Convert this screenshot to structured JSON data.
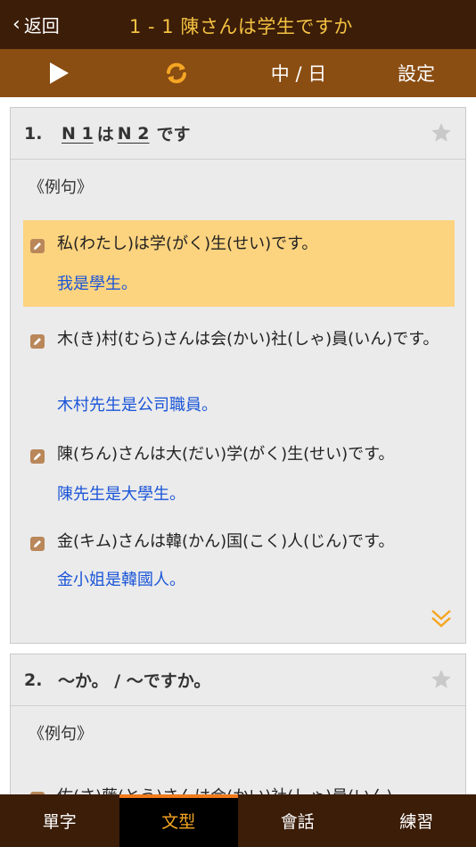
{
  "header": {
    "back_label": "返回",
    "title": "1 - 1 陳さんは学生ですか"
  },
  "toolbar": {
    "play_icon": "play-icon",
    "repeat_icon": "repeat-icon",
    "lang_label": "中 / 日",
    "settings_label": "設定"
  },
  "cards": [
    {
      "number": "1.",
      "pattern_n1": "N 1",
      "pattern_wa": "は",
      "pattern_n2": "N 2",
      "pattern_desu": "です",
      "examples_label": "《例句》",
      "examples": [
        {
          "jp": "私(わたし)は学(がく)生(せい)です。",
          "zh": "我是學生。"
        },
        {
          "jp": "木(き)村(むら)さんは会(かい)社(しゃ)員(いん)です。",
          "zh": "木村先生是公司職員。"
        },
        {
          "jp": "陳(ちん)さんは大(だい)学(がく)生(せい)です。",
          "zh": "陳先生是大學生。"
        },
        {
          "jp": "金(キム)さんは韓(かん)国(こく)人(じん)です。",
          "zh": "金小姐是韓國人。"
        }
      ]
    },
    {
      "number": "2.",
      "pattern": "～か。 / ～ですか。",
      "examples_label": "《例句》",
      "examples": [
        {
          "jp": "佐(さ)藤(とう)さんは会(かい)社(しゃ)員(いん)"
        }
      ]
    }
  ],
  "tabs": [
    {
      "label": "單字"
    },
    {
      "label": "文型"
    },
    {
      "label": "會話"
    },
    {
      "label": "練習"
    }
  ],
  "colors": {
    "accent": "#f5a623",
    "link": "#1a55d8",
    "highlight": "#fcd37f",
    "header": "#3b1d08",
    "toolbar": "#8a4d12"
  }
}
